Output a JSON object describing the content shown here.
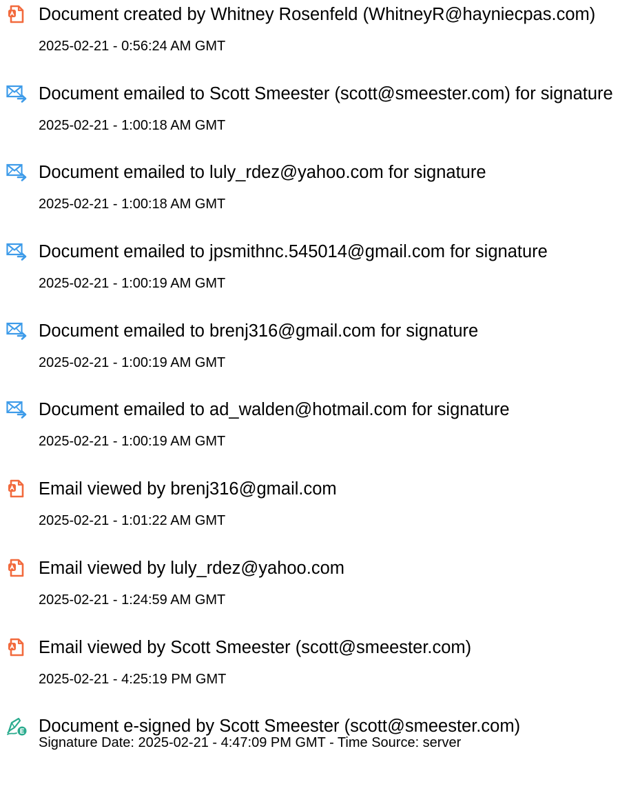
{
  "events": [
    {
      "kind": "document",
      "icon": "document-icon",
      "title": "Document created by Whitney Rosenfeld (WhitneyR@hayniecpas.com)",
      "time": "2025-02-21 - 0:56:24 AM GMT"
    },
    {
      "kind": "email",
      "icon": "email-sent-icon",
      "title": "Document emailed to Scott Smeester (scott@smeester.com) for signature",
      "time": "2025-02-21 - 1:00:18 AM GMT"
    },
    {
      "kind": "email",
      "icon": "email-sent-icon",
      "title": "Document emailed to luly_rdez@yahoo.com for signature",
      "time": "2025-02-21 - 1:00:18 AM GMT"
    },
    {
      "kind": "email",
      "icon": "email-sent-icon",
      "title": "Document emailed to jpsmithnc.545014@gmail.com for signature",
      "time": "2025-02-21 - 1:00:19 AM GMT"
    },
    {
      "kind": "email",
      "icon": "email-sent-icon",
      "title": "Document emailed to brenj316@gmail.com for signature",
      "time": "2025-02-21 - 1:00:19 AM GMT"
    },
    {
      "kind": "email",
      "icon": "email-sent-icon",
      "title": "Document emailed to ad_walden@hotmail.com for signature",
      "time": "2025-02-21 - 1:00:19 AM GMT"
    },
    {
      "kind": "document",
      "icon": "document-icon",
      "title": "Email viewed by brenj316@gmail.com",
      "time": "2025-02-21 - 1:01:22 AM GMT"
    },
    {
      "kind": "document",
      "icon": "document-icon",
      "title": "Email viewed by luly_rdez@yahoo.com",
      "time": "2025-02-21 - 1:24:59 AM GMT"
    },
    {
      "kind": "document",
      "icon": "document-icon",
      "title": "Email viewed by Scott Smeester (scott@smeester.com)",
      "time": "2025-02-21 - 4:25:19 PM GMT"
    },
    {
      "kind": "signed",
      "icon": "e-sign-pen-icon",
      "title": "Document e-signed by Scott Smeester (scott@smeester.com)",
      "time": "Signature Date: 2025-02-21 - 4:47:09 PM GMT - Time Source: server"
    }
  ],
  "colors": {
    "document_icon": "#f26a3d",
    "email_icon": "#3d9be9",
    "esign_icon": "#2aab8e"
  }
}
